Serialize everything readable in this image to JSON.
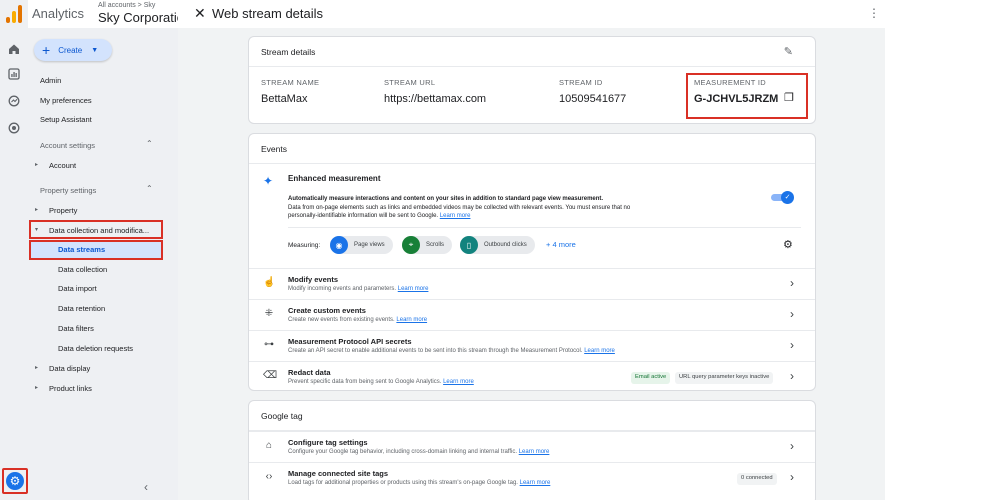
{
  "header": {
    "app_title": "Analytics",
    "breadcrumb": "All accounts > Sky",
    "account_name": "Sky Corporatio"
  },
  "rail": {
    "icons": [
      "home-icon",
      "reports-icon",
      "explore-icon",
      "advertising-icon",
      "admin-gear-icon"
    ]
  },
  "nav": {
    "create_label": "Create",
    "admin": "Admin",
    "my_preferences": "My preferences",
    "setup_assistant": "Setup Assistant",
    "account_settings": "Account settings",
    "account": "Account",
    "property_settings": "Property settings",
    "property": "Property",
    "data_collection": "Data collection and modifica...",
    "data_streams": "Data streams",
    "data_collection_sub": "Data collection",
    "data_import": "Data import",
    "data_retention": "Data retention",
    "data_filters": "Data filters",
    "data_deletion": "Data deletion requests",
    "data_display": "Data display",
    "product_links": "Product links"
  },
  "panel": {
    "title": "Web stream details"
  },
  "stream_details": {
    "heading": "Stream details",
    "stream_name_label": "STREAM NAME",
    "stream_name": "BettaMax",
    "stream_url_label": "STREAM URL",
    "stream_url": "https://bettamax.com",
    "stream_id_label": "STREAM ID",
    "stream_id": "10509541677",
    "measurement_id_label": "MEASUREMENT ID",
    "measurement_id": "G-JCHVL5JRZM"
  },
  "events": {
    "heading": "Events",
    "enhanced_title": "Enhanced measurement",
    "enhanced_desc_bold": "Automatically measure interactions and content on your sites in addition to standard page view measurement.",
    "enhanced_desc": "Data from on-page elements such as links and embedded videos may be collected with relevant events. You must ensure that no personally-identifiable information will be sent to Google.",
    "learn_more": "Learn more",
    "enhanced_enabled": true,
    "measuring_label": "Measuring:",
    "chips": [
      {
        "label": "Page views",
        "color": "#1a73e8",
        "icon": "eye-icon"
      },
      {
        "label": "Scrolls",
        "color": "#188038",
        "icon": "crosshair-icon"
      },
      {
        "label": "Outbound clicks",
        "color": "#12837e",
        "icon": "mouse-icon"
      }
    ],
    "more_label": "+ 4 more",
    "rows": [
      {
        "title": "Modify events",
        "desc": "Modify incoming events and parameters.",
        "icon": "touch-icon"
      },
      {
        "title": "Create custom events",
        "desc": "Create new events from existing events.",
        "icon": "sparkle-click-icon"
      },
      {
        "title": "Measurement Protocol API secrets",
        "desc": "Create an API secret to enable additional events to be sent into this stream through the Measurement Protocol.",
        "icon": "key-icon"
      },
      {
        "title": "Redact data",
        "desc": "Prevent specific data from being sent to Google Analytics.",
        "icon": "eraser-icon"
      }
    ],
    "redact_badges": [
      "Email active",
      "URL query parameter keys inactive"
    ]
  },
  "google_tag": {
    "heading": "Google tag",
    "rows": [
      {
        "title": "Configure tag settings",
        "desc": "Configure your Google tag behavior, including cross-domain linking and internal traffic.",
        "icon": "tag-icon"
      },
      {
        "title": "Manage connected site tags",
        "desc": "Load tags for additional properties or products using this stream's on-page Google tag.",
        "icon": "code-icon"
      }
    ],
    "connected_badge": "0 connected"
  },
  "colors": {
    "accent": "#1a73e8",
    "highlight_border": "#d93025",
    "active_bg": "#d3e3fd"
  }
}
